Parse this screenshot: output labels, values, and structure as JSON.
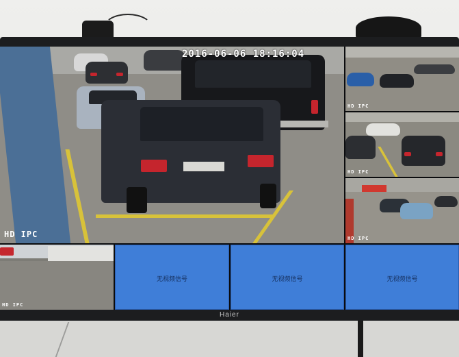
{
  "overlay": {
    "timestamp": "2016-06-06 18:16:04",
    "main_label": "HD IPC",
    "small_label": "HD IPC"
  },
  "monitor": {
    "brand": "Haier"
  },
  "grid": {
    "cells": [
      {
        "id": "main",
        "label": "HD IPC"
      },
      {
        "id": "top-right",
        "label": "HD IPC"
      },
      {
        "id": "mid-right",
        "label": "HD IPC"
      },
      {
        "id": "lower-right",
        "label": "HD IPC"
      },
      {
        "id": "bottom-left",
        "label": "HD IPC"
      },
      {
        "id": "bottom-2",
        "message": "无视频信号"
      },
      {
        "id": "bottom-3",
        "message": "无视频信号"
      },
      {
        "id": "bottom-4",
        "message": "无视频信号"
      }
    ]
  },
  "colors": {
    "no_signal_blue": "#3f7ed8",
    "label_white": "#ffffff",
    "active_outline": "#7fd3a8"
  }
}
